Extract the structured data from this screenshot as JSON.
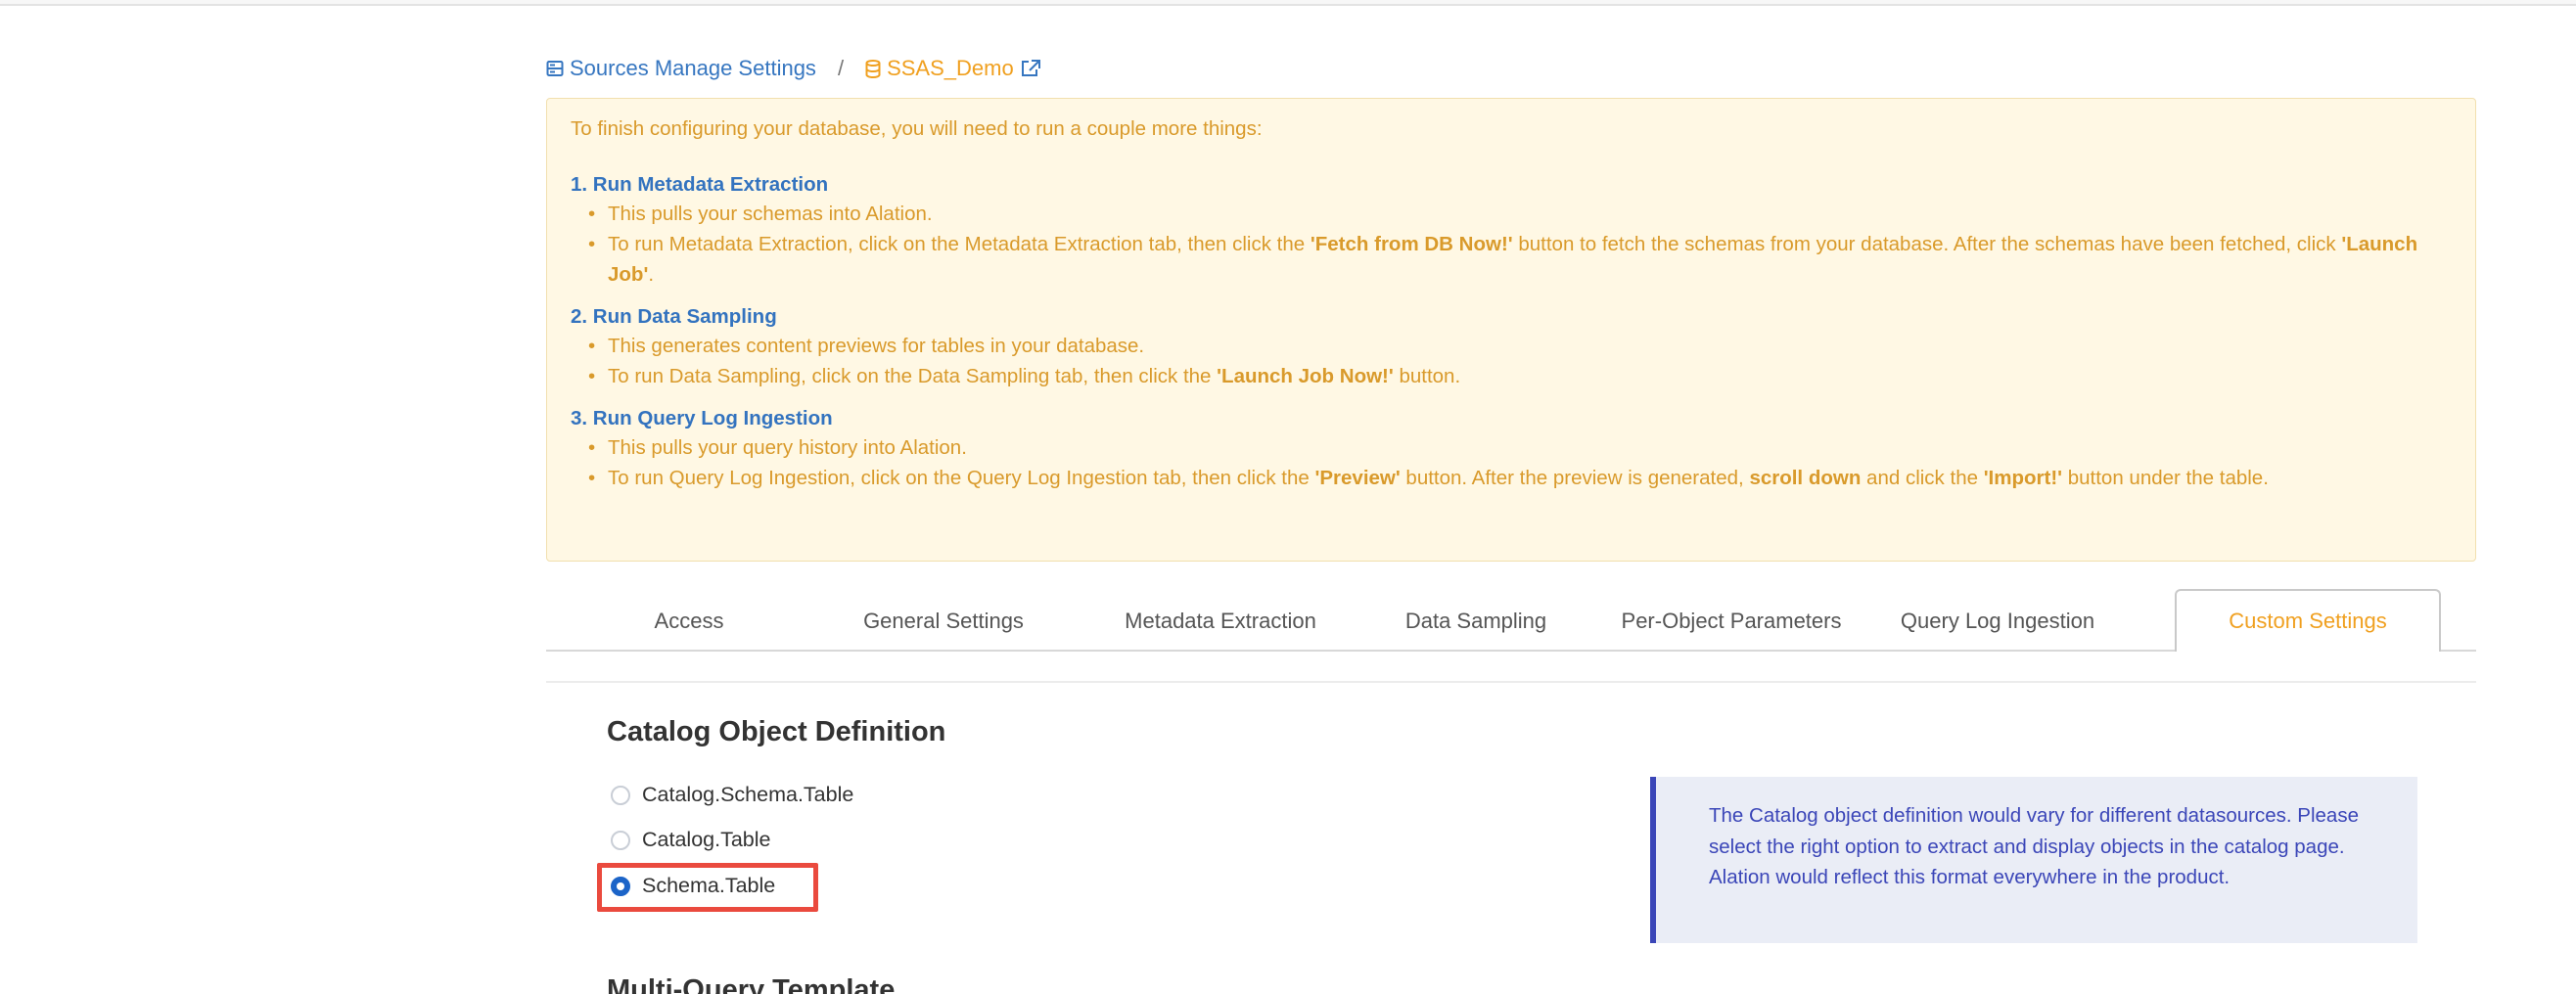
{
  "breadcrumb": {
    "parent_label": "Sources Manage Settings",
    "separator": "/",
    "current_label": "SSAS_Demo"
  },
  "notice": {
    "intro": "To finish configuring your database, you will need to run a couple more things:",
    "steps": [
      {
        "title": "1. Run Metadata Extraction",
        "bullets": [
          {
            "text": "This pulls your schemas into Alation."
          },
          {
            "pre": "To run Metadata Extraction, click on the Metadata Extraction tab, then click the ",
            "b1": "'Fetch from DB Now!'",
            "mid": " button to fetch the schemas from your database. After the schemas have been fetched, click ",
            "b2": "'Launch Job'",
            "post": "."
          }
        ]
      },
      {
        "title": "2. Run Data Sampling",
        "bullets": [
          {
            "text": "This generates content previews for tables in your database."
          },
          {
            "pre": "To run Data Sampling, click on the Data Sampling tab, then click the ",
            "b1": "'Launch Job Now!'",
            "post": " button."
          }
        ]
      },
      {
        "title": "3. Run Query Log Ingestion",
        "bullets": [
          {
            "text": "This pulls your query history into Alation."
          },
          {
            "pre": "To run Query Log Ingestion, click on the Query Log Ingestion tab, then click the ",
            "b1": "'Preview'",
            "mid": " button. After the preview is generated, ",
            "b2": "scroll down",
            "mid2": " and click the ",
            "b3": "'Import!'",
            "post": " button under the table."
          }
        ]
      }
    ]
  },
  "tabs": [
    {
      "label": "Access"
    },
    {
      "label": "General Settings"
    },
    {
      "label": "Metadata Extraction"
    },
    {
      "label": "Data Sampling"
    },
    {
      "label": "Per-Object Parameters"
    },
    {
      "label": "Query Log Ingestion"
    },
    {
      "label": "Custom Settings",
      "active": true
    }
  ],
  "catalog": {
    "title": "Catalog Object Definition",
    "options": [
      {
        "label": "Catalog.Schema.Table",
        "checked": false
      },
      {
        "label": "Catalog.Table",
        "checked": false
      },
      {
        "label": "Schema.Table",
        "checked": true
      }
    ],
    "info_text": "The Catalog object definition would vary for different datasources. Please select the right option to extract and display objects in the catalog page. Alation would reflect this format everywhere in the product."
  },
  "next_section_title": "Multi-Query Template",
  "colors": {
    "link_blue": "#3676c0",
    "accent_orange": "#f0a020",
    "notice_bg": "#fff8e4",
    "info_bg": "#eaedf6",
    "highlight_red": "#ea4a3e"
  }
}
